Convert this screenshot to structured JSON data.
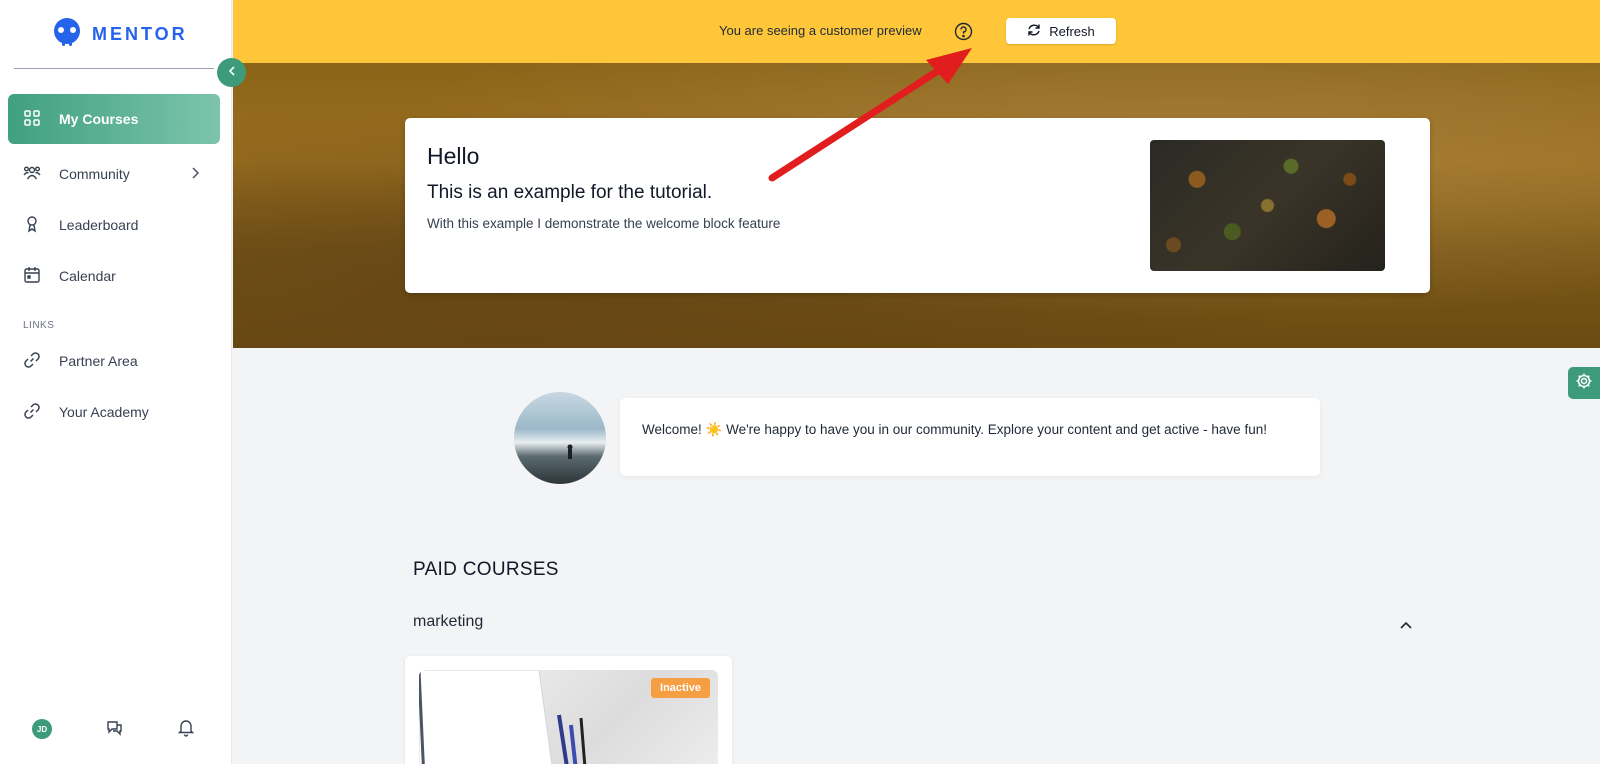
{
  "sidebar": {
    "logo_text": "MENTOR",
    "items": [
      {
        "label": "My Courses"
      },
      {
        "label": "Community"
      },
      {
        "label": "Leaderboard"
      },
      {
        "label": "Calendar"
      }
    ],
    "links_label": "LINKS",
    "links": [
      {
        "label": "Partner Area"
      },
      {
        "label": "Your Academy"
      }
    ],
    "user_initials": "JD"
  },
  "banner": {
    "text": "You are seeing a customer preview",
    "refresh_label": "Refresh"
  },
  "hero": {
    "title": "Hello",
    "subtitle": "This is an example for the tutorial.",
    "description": "With this example I demonstrate the welcome block feature"
  },
  "welcome": {
    "message": "Welcome! ☀️ We're happy to have you in our community. Explore your content and get active - have fun!"
  },
  "courses": {
    "heading": "PAID COURSES",
    "category": "marketing",
    "items": [
      {
        "status": "Inactive"
      }
    ]
  },
  "colors": {
    "brand": "#2563eb",
    "accent": "#3d9b7c",
    "banner": "#fec638",
    "badge": "#f59e42"
  }
}
